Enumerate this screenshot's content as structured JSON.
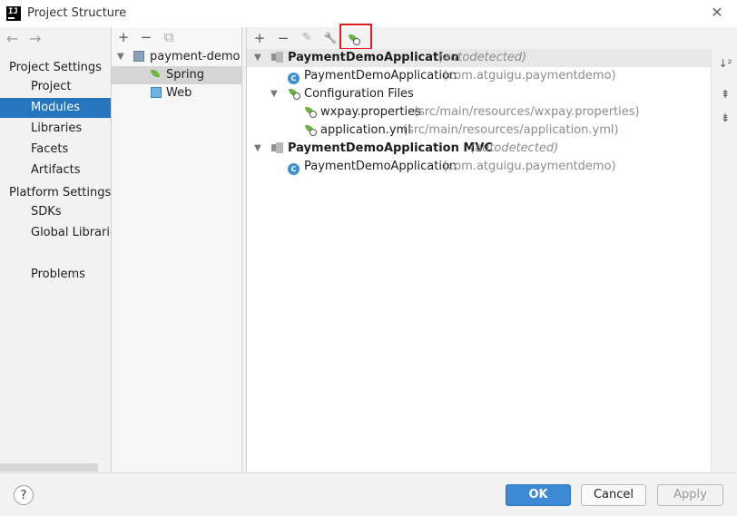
{
  "window": {
    "title": "Project Structure",
    "close_glyph": "✕"
  },
  "nav": {
    "back_glyph": "←",
    "forward_glyph": "→",
    "project_settings_header": "Project Settings",
    "project_settings_items": [
      "Project",
      "Modules",
      "Libraries",
      "Facets",
      "Artifacts"
    ],
    "selected_item": "Modules",
    "platform_settings_header": "Platform Settings",
    "platform_settings_items": [
      "SDKs",
      "Global Libraries"
    ],
    "problems_label": "Problems"
  },
  "modules_panel": {
    "toolbar": {
      "add": "+",
      "remove": "−",
      "copy": "⧉"
    },
    "module_name": "payment-demo",
    "facets": [
      "Spring",
      "Web"
    ],
    "selected_facet": "Spring"
  },
  "spring_panel": {
    "toolbar": {
      "add": "+",
      "remove": "−",
      "edit": "✎",
      "settings": "🔧"
    },
    "tree": [
      {
        "label": "PaymentDemoApplication",
        "suffix": "(autodetected)"
      },
      {
        "label": "PaymentDemoApplication",
        "suffix": "(com.atguigu.paymentdemo)"
      },
      {
        "label": "Configuration Files",
        "suffix": ""
      },
      {
        "label": "wxpay.properties",
        "suffix": "(src/main/resources/wxpay.properties)"
      },
      {
        "label": "application.yml",
        "suffix": "(src/main/resources/application.yml)"
      },
      {
        "label": "PaymentDemoApplication MVC",
        "suffix": "(autodetected)"
      },
      {
        "label": "PaymentDemoApplication",
        "suffix": "(com.atguigu.paymentdemo)"
      }
    ],
    "sidebar": {
      "sort": "↓²",
      "expand": "⇞",
      "collapse": "⇟"
    }
  },
  "footer": {
    "help": "?",
    "ok": "OK",
    "cancel": "Cancel",
    "apply": "Apply"
  },
  "colors": {
    "selection": "#2675bf",
    "highlight_box": "#e02020",
    "spring_green": "#6db33f",
    "ok_button": "#3c8ad6"
  }
}
